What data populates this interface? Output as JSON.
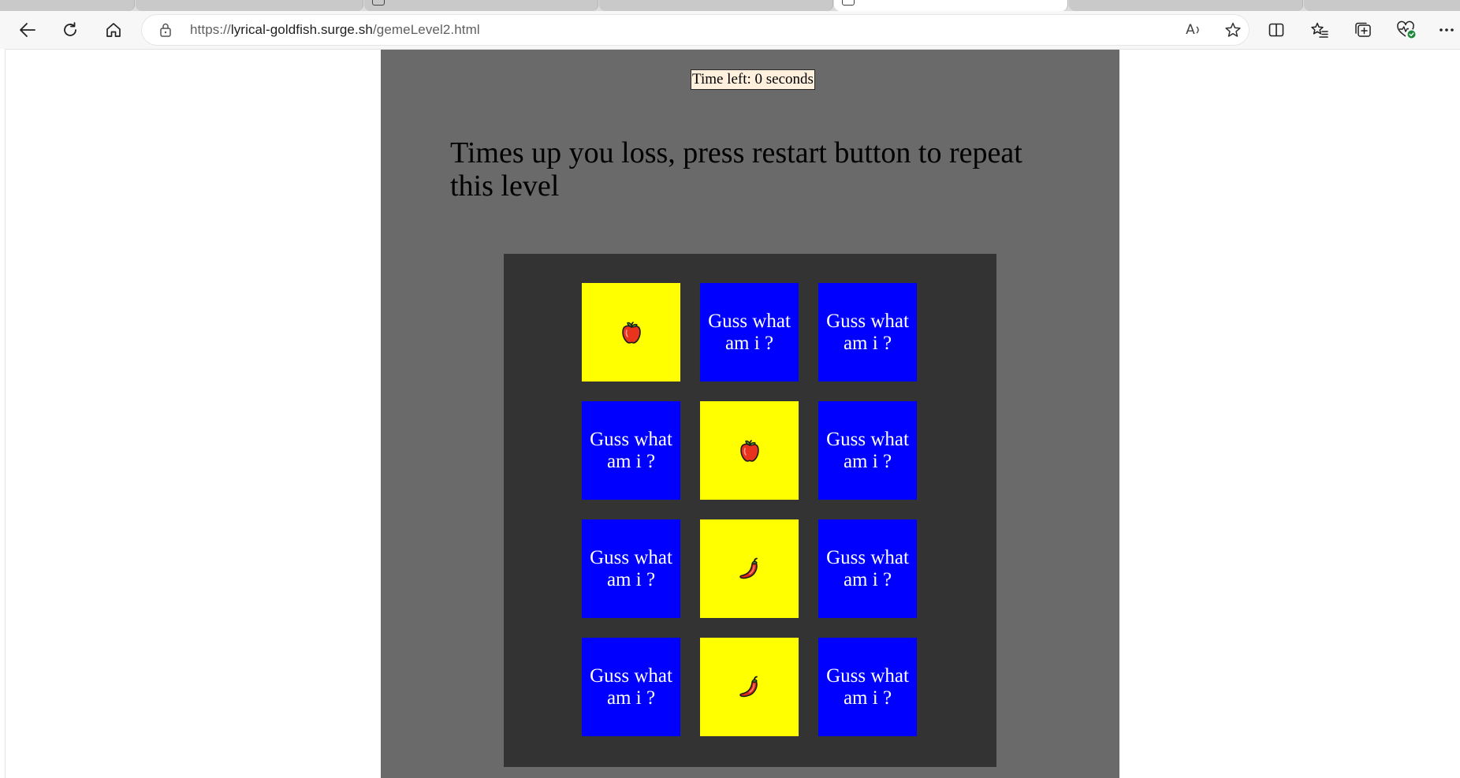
{
  "browser": {
    "url_scheme": "https://",
    "url_host": "lyrical-goldfish.surge.sh",
    "url_path": "/gemeLevel2.html",
    "read_aloud_label": "A"
  },
  "game": {
    "timer_text": "Time left: 0 seconds",
    "message": "Times up you loss, press restart button to repeat this level",
    "hidden_card_label": "Guss what am i ?",
    "cards": [
      {
        "state": "revealed",
        "fruit": "apple-icon"
      },
      {
        "state": "hidden",
        "label": "Guss what am i ?"
      },
      {
        "state": "hidden",
        "label": "Guss what am i ?"
      },
      {
        "state": "hidden",
        "label": "Guss what am i ?"
      },
      {
        "state": "revealed",
        "fruit": "apple-icon"
      },
      {
        "state": "hidden",
        "label": "Guss what am i ?"
      },
      {
        "state": "hidden",
        "label": "Guss what am i ?"
      },
      {
        "state": "revealed",
        "fruit": "chili-pepper-icon"
      },
      {
        "state": "hidden",
        "label": "Guss what am i ?"
      },
      {
        "state": "hidden",
        "label": "Guss what am i ?"
      },
      {
        "state": "revealed",
        "fruit": "chili-pepper-icon"
      },
      {
        "state": "hidden",
        "label": "Guss what am i ?"
      }
    ]
  },
  "colors": {
    "page_background": "#6a6a6a",
    "board_background": "#333333",
    "hidden_card": "#0000ff",
    "revealed_card": "#ffff00",
    "timer_background": "#fff0dd"
  }
}
